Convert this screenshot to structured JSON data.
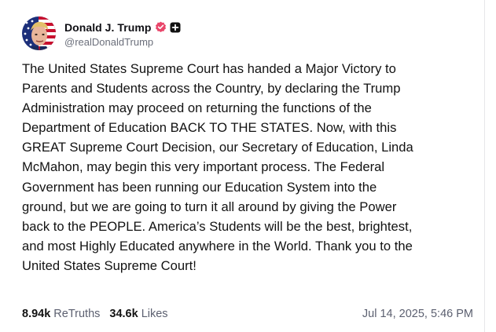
{
  "author": {
    "display_name": "Donald J. Trump",
    "handle": "@realDonaldTrump",
    "verified_icon": "verified-badge-icon",
    "extra_icon": "plus-icon"
  },
  "post": {
    "text": "The United States Supreme Court has handed a Major Victory to\nParents and Students across the Country, by declaring the Trump\nAdministration may proceed on returning the functions of the\nDepartment of Education BACK TO THE STATES. Now, with this\nGREAT Supreme Court Decision, our Secretary of Education, Linda\nMcMahon, may begin this very important process. The Federal\nGovernment has been running our Education System into the\nground, but we are going to turn it all around by giving the Power\nback to the PEOPLE. America’s Students will be the best, brightest,\nand most Highly Educated anywhere in the World. Thank you to the\nUnited States Supreme Court!"
  },
  "stats": {
    "retruths_count": "8.94k",
    "retruths_label": "ReTruths",
    "likes_count": "34.6k",
    "likes_label": "Likes"
  },
  "timestamp": "Jul 14, 2025, 5:46 PM",
  "colors": {
    "verified_badge": "#e9466a",
    "text": "#121212",
    "muted": "#5c6070"
  }
}
